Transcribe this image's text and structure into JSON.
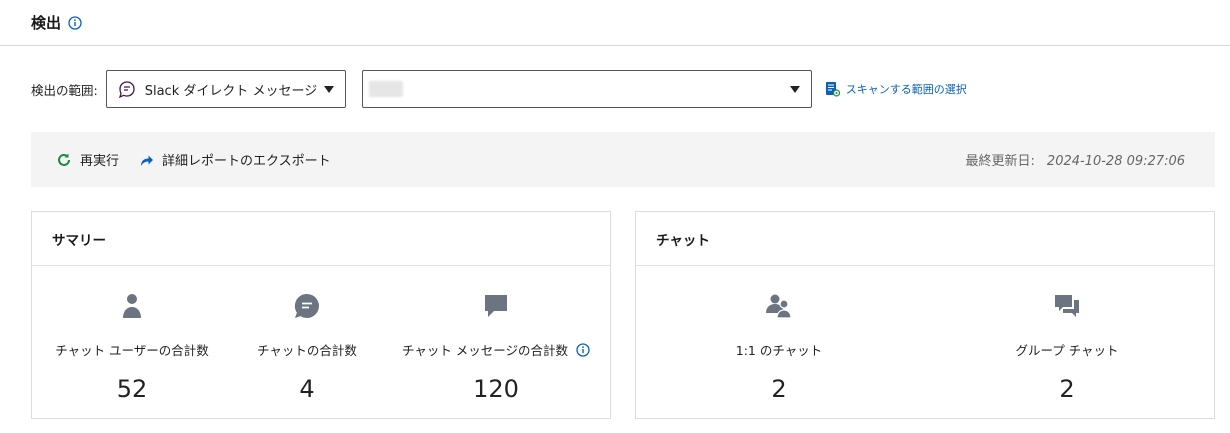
{
  "header": {
    "title": "検出",
    "info_icon": "info-circle-icon"
  },
  "scope": {
    "label": "検出の範囲:",
    "selected": "Slack ダイレクト メッセージ",
    "second_value": "",
    "scan_link": "スキャンする範囲の選択"
  },
  "toolbar": {
    "rerun": "再実行",
    "export": "詳細レポートのエクスポート",
    "updated_label": "最終更新日:",
    "updated_time": "2024-10-28 09:27:06"
  },
  "summary": {
    "title": "サマリー",
    "stats": [
      {
        "icon": "user-icon",
        "label": "チャット ユーザーの合計数",
        "value": "52"
      },
      {
        "icon": "chat-bubble-icon",
        "label": "チャットの合計数",
        "value": "4"
      },
      {
        "icon": "message-icon",
        "label": "チャット メッセージの合計数",
        "value": "120"
      }
    ]
  },
  "chat": {
    "title": "チャット",
    "stats": [
      {
        "icon": "users-icon",
        "label": "1:1 のチャット",
        "value": "2"
      },
      {
        "icon": "group-chat-icon",
        "label": "グループ チャット",
        "value": "2"
      }
    ]
  },
  "colors": {
    "accent": "#0a62b8",
    "icon_gray": "#6b7480",
    "rerun_green": "#1e8a3e",
    "toolbar_bg": "#f4f4f4"
  }
}
